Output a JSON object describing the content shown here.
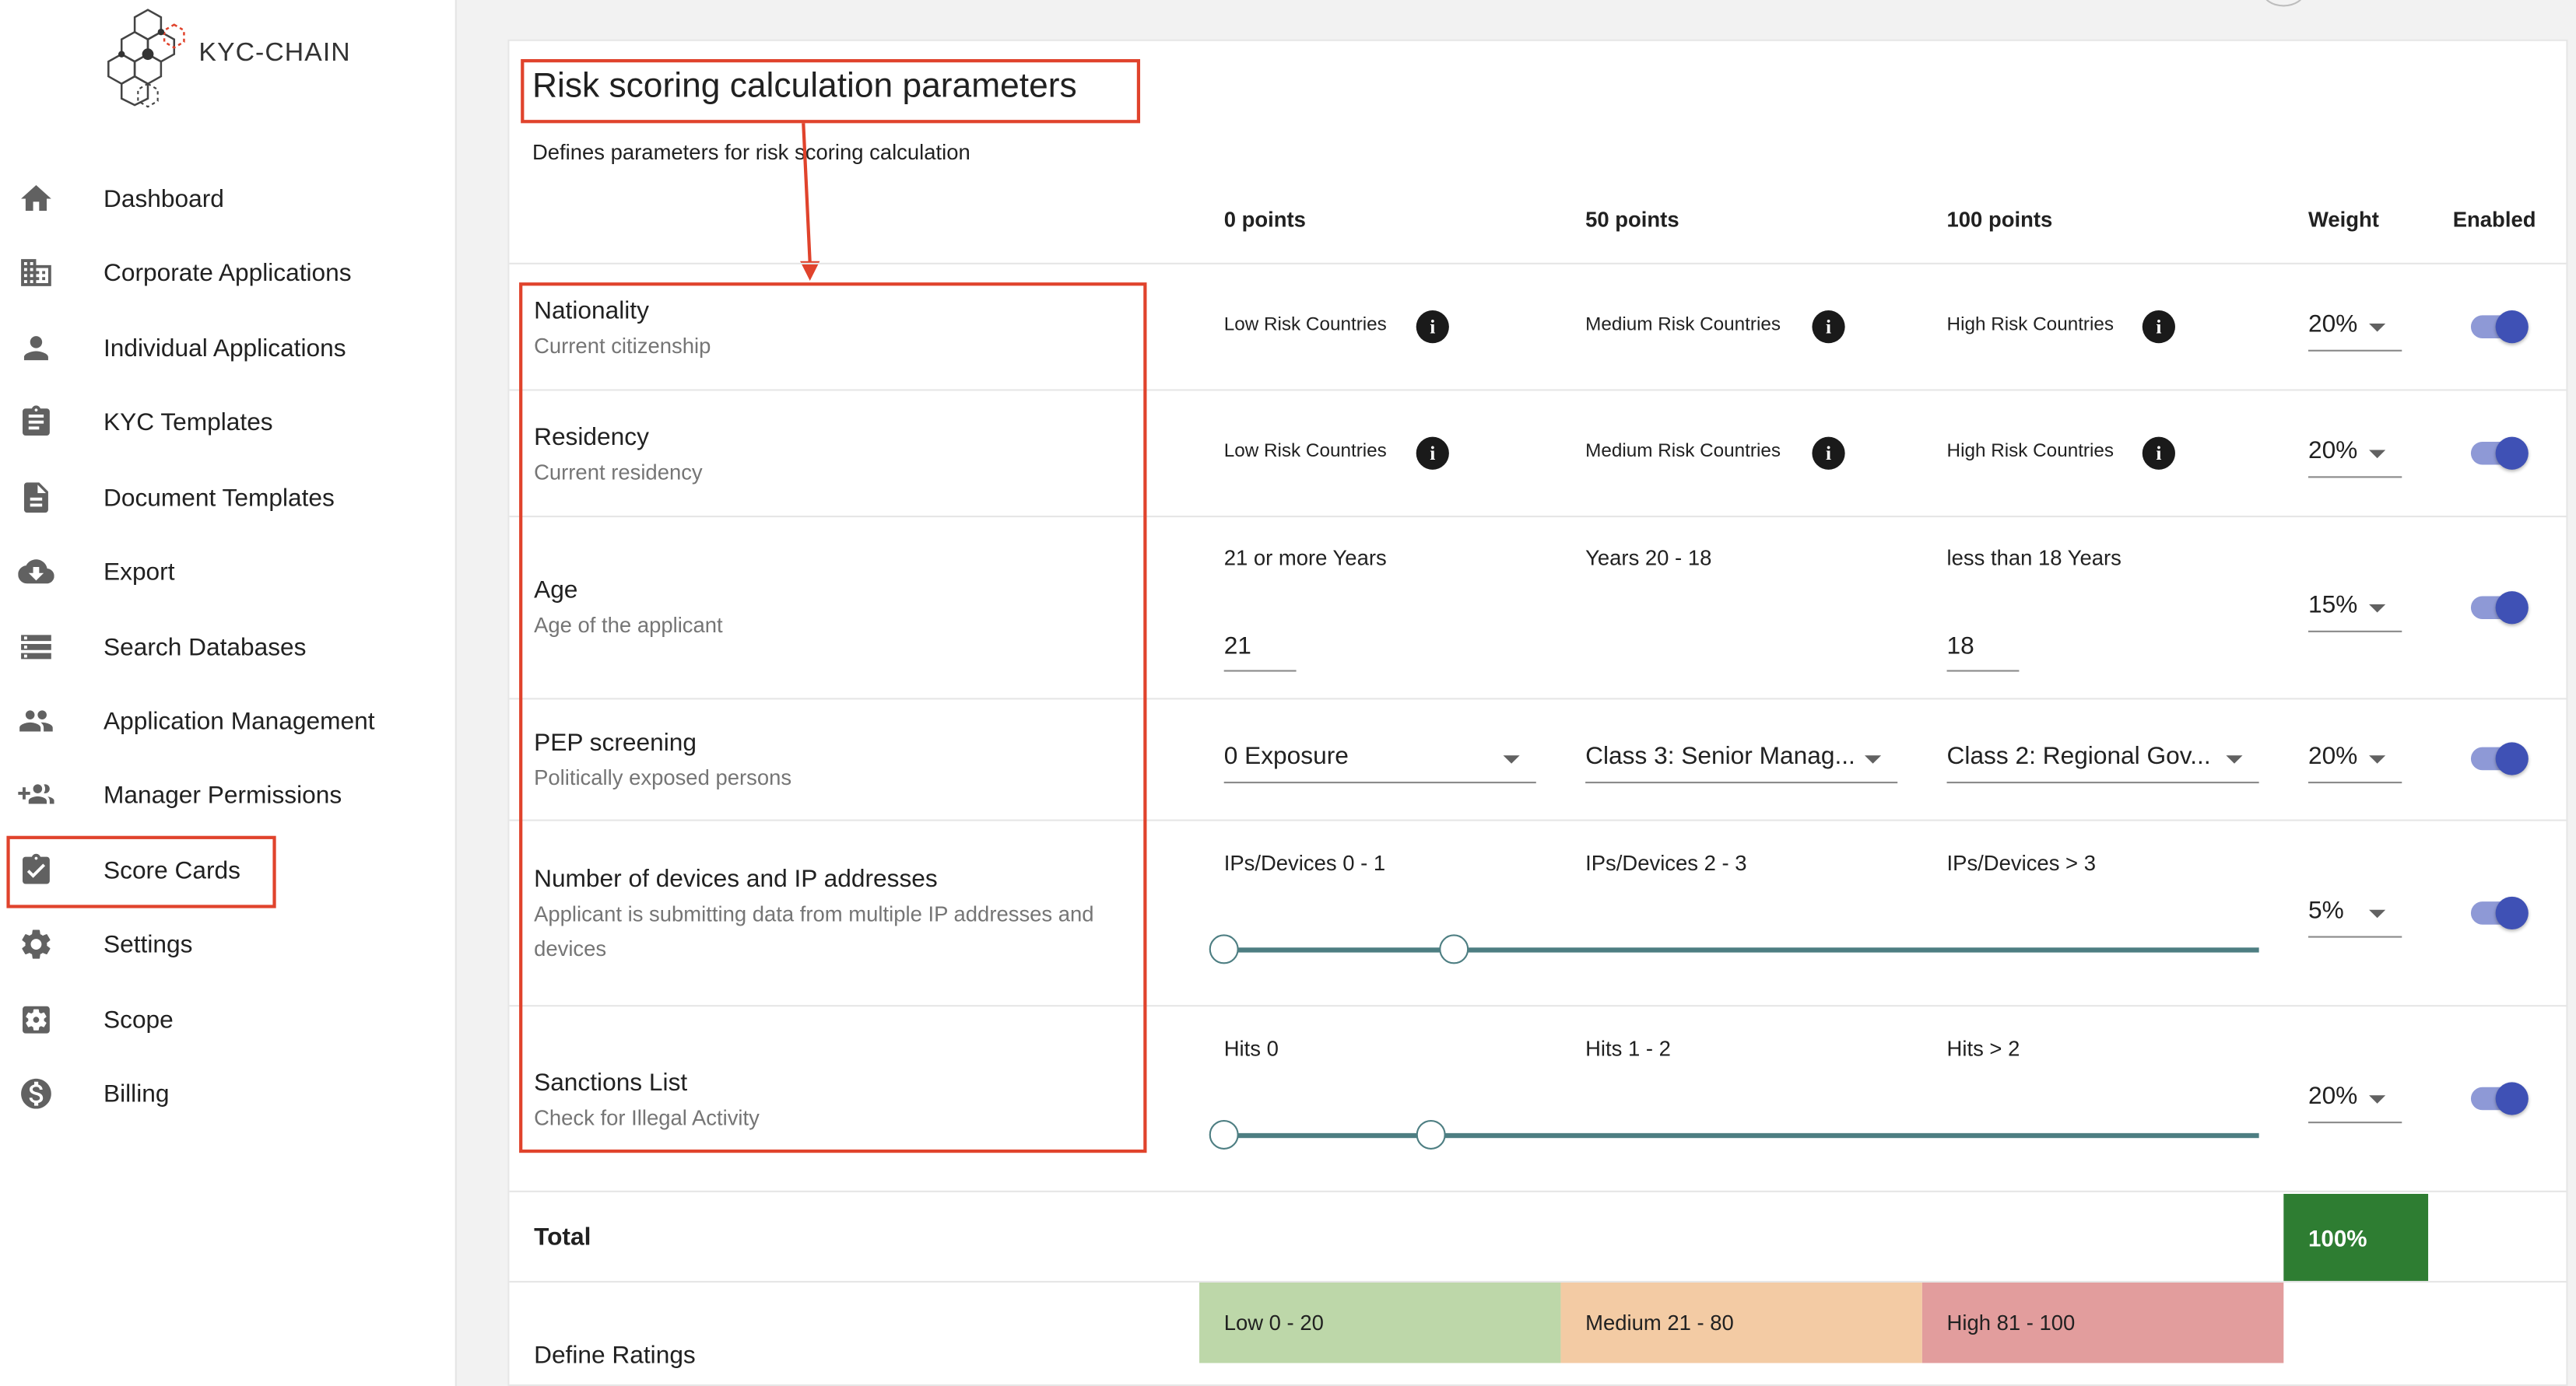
{
  "brand": {
    "name": "KYC-CHAIN"
  },
  "sidebar": {
    "items": [
      {
        "label": "Dashboard",
        "icon": "home-icon"
      },
      {
        "label": "Corporate Applications",
        "icon": "building-icon"
      },
      {
        "label": "Individual Applications",
        "icon": "person-icon"
      },
      {
        "label": "KYC Templates",
        "icon": "clipboard-icon"
      },
      {
        "label": "Document Templates",
        "icon": "document-icon"
      },
      {
        "label": "Export",
        "icon": "cloud-download-icon"
      },
      {
        "label": "Search Databases",
        "icon": "database-list-icon"
      },
      {
        "label": "Application Management",
        "icon": "people-icon"
      },
      {
        "label": "Manager Permissions",
        "icon": "group-add-icon"
      },
      {
        "label": "Score Cards",
        "icon": "assignment-check-icon"
      },
      {
        "label": "Settings",
        "icon": "gear-icon"
      },
      {
        "label": "Scope",
        "icon": "settings-box-icon"
      },
      {
        "label": "Billing",
        "icon": "dollar-icon"
      }
    ],
    "active": "Score Cards"
  },
  "page": {
    "title": "Risk scoring calculation parameters",
    "subtitle": "Defines parameters for risk scoring calculation"
  },
  "columns": {
    "c0": "0 points",
    "c50": "50 points",
    "c100": "100 points",
    "weight": "Weight",
    "enabled": "Enabled"
  },
  "params": {
    "nationality": {
      "title": "Nationality",
      "desc": "Current citizenship",
      "low": "Low Risk Countries",
      "medium": "Medium Risk Countries",
      "high": "High Risk Countries",
      "weight": "20%",
      "enabled": true
    },
    "residency": {
      "title": "Residency",
      "desc": "Current residency",
      "low": "Low Risk Countries",
      "medium": "Medium Risk Countries",
      "high": "High Risk Countries",
      "weight": "20%",
      "enabled": true
    },
    "age": {
      "title": "Age",
      "desc": "Age of the applicant",
      "low": "21 or more Years",
      "medium": "Years 20 - 18",
      "high": "less than 18 Years",
      "low_value": "21",
      "high_value": "18",
      "weight": "15%",
      "enabled": true
    },
    "pep": {
      "title": "PEP screening",
      "desc": "Politically exposed persons",
      "low": "0 Exposure",
      "medium": "Class 3: Senior Manag...",
      "high": "Class 2: Regional Gov...",
      "weight": "20%",
      "enabled": true
    },
    "devices": {
      "title": "Number of devices and IP addresses",
      "desc": "Applicant is submitting data from multiple IP addresses and devices",
      "low": "IPs/Devices 0 - 1",
      "medium": "IPs/Devices 2 - 3",
      "high": "IPs/Devices > 3",
      "weight": "5%",
      "enabled": true
    },
    "sanctions": {
      "title": "Sanctions List",
      "desc": "Check for Illegal Activity",
      "low": "Hits 0",
      "medium": "Hits 1 - 2",
      "high": "Hits > 2",
      "weight": "20%",
      "enabled": true
    }
  },
  "total": {
    "label": "Total",
    "value": "100%"
  },
  "ratings": {
    "label": "Define Ratings",
    "low": "Low 0 - 20",
    "medium": "Medium 21 - 80",
    "high": "High 81 - 100",
    "colors": {
      "low": "#bdd7a9",
      "medium": "#f3cba4",
      "high": "#e29d9d"
    }
  },
  "colors": {
    "annotation": "#e0432c",
    "accent": "#3f51b5",
    "total": "#2e7d32",
    "slider": "#4d7e82"
  }
}
